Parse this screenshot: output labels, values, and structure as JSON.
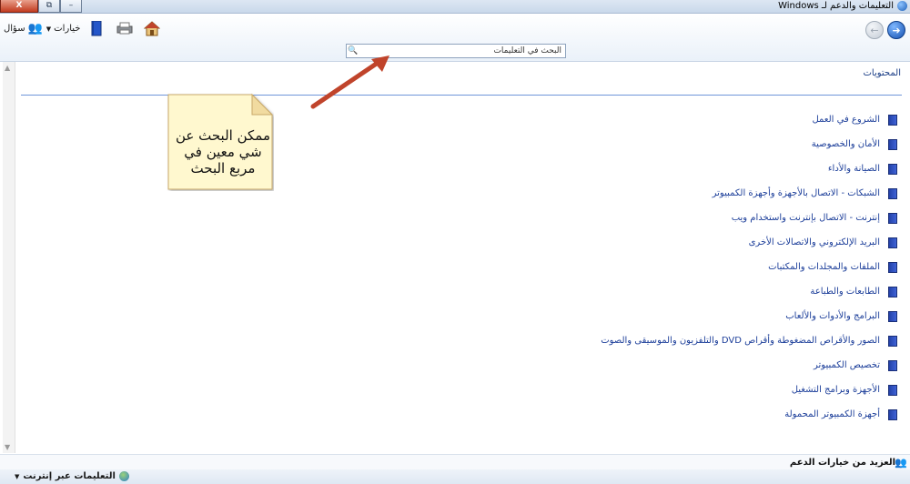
{
  "window": {
    "title": "التعليمات والدعم لـ Windows",
    "buttons": {
      "close": "X",
      "restore": "⧉",
      "minimize": "–"
    }
  },
  "toolbar": {
    "options_label": "خيارات",
    "ask_label": "سؤال",
    "icons": [
      "home-icon",
      "print-icon",
      "browse-help-icon",
      "ask-icon"
    ]
  },
  "search": {
    "placeholder": "البحث في التعليمات",
    "value": ""
  },
  "contents": {
    "heading": "المحتويات",
    "topics": [
      "الشروع في العمل",
      "الأمان والخصوصية",
      "الصيانة والأداء",
      "الشبكات - الاتصال بالأجهزة وأجهزة الكمبيوتر",
      "إنترنت - الاتصال بإنترنت واستخدام ويب",
      "البريد الإلكتروني والاتصالات الأخرى",
      "الملفات والمجلدات والمكتبات",
      "الطابعات والطباعة",
      "البرامج والأدوات والألعاب",
      "الصور والأقراص المضغوطة وأقراص DVD والتلفزيون والموسيقى والصوت",
      "تخصيص الكمبيوتر",
      "الأجهزة وبرامج التشغيل",
      "أجهزة الكمبيوتر المحمولة"
    ]
  },
  "annotation": {
    "lines": [
      "ممكن البحث عن",
      "شي معين في",
      "مربع البحث"
    ]
  },
  "footer": {
    "more_support": "العزيد من خيارات الدعم",
    "online_help": "التعليمات عبر إنترنت"
  },
  "colors": {
    "link": "#1d3f9a",
    "divider": "#6f96d9",
    "arrow": "#c0442b",
    "note": "#fff8cf"
  }
}
